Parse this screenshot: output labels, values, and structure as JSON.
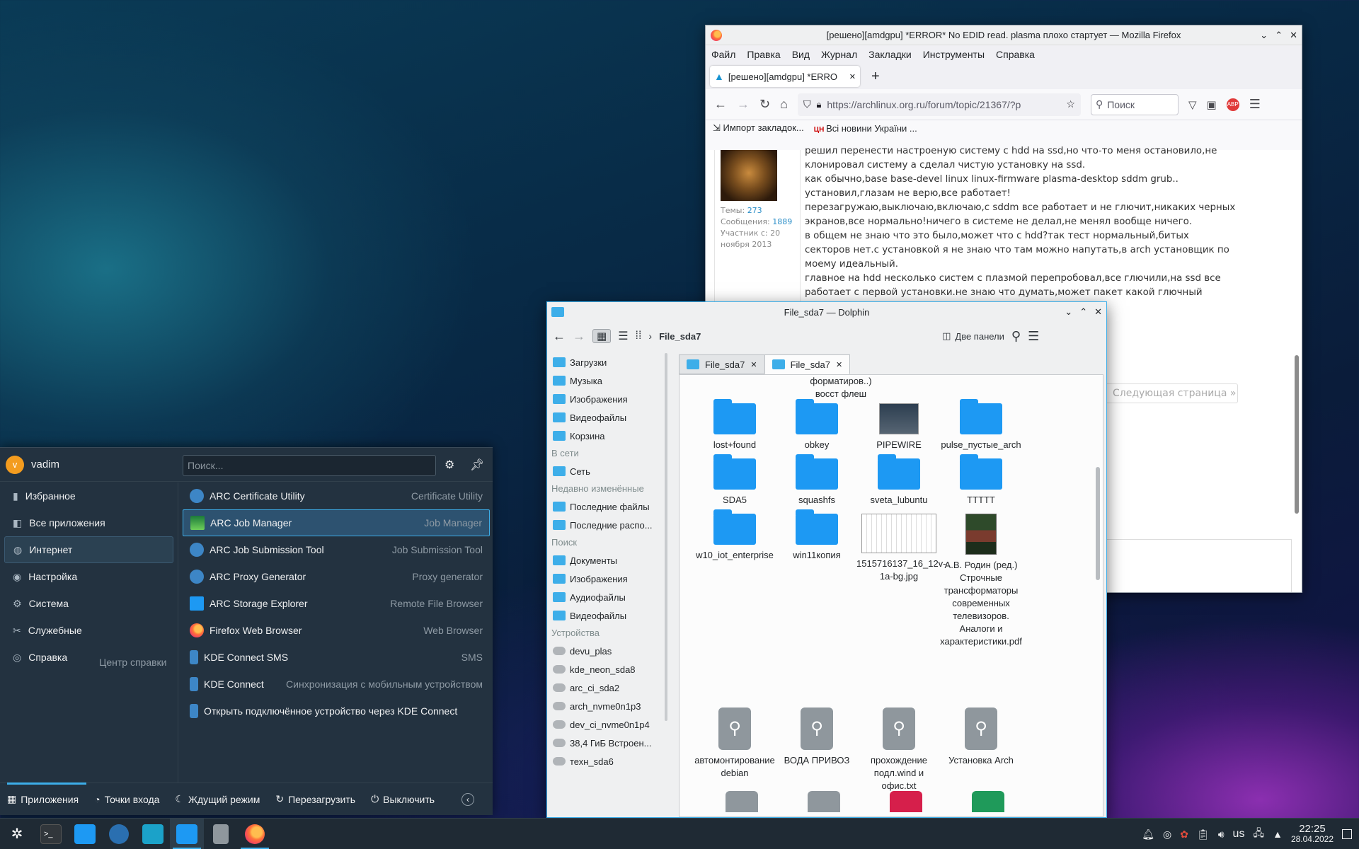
{
  "firefox": {
    "title": "[решено][amdgpu] *ERROR* No EDID read. plasma плохо стартует — Mozilla Firefox",
    "menu": [
      "Файл",
      "Правка",
      "Вид",
      "Журнал",
      "Закладки",
      "Инструменты",
      "Справка"
    ],
    "tab_label": "[решено][amdgpu] *ERRO",
    "url": "https://archlinux.org.ru/forum/topic/21367/?p",
    "search_placeholder": "Поиск",
    "bookmarks": [
      "Импорт закладок...",
      "Всі новини України ..."
    ],
    "post_text": [
      "решил перенести настроеную систему с hdd на ssd,но что-то меня остановило,не",
      "клонировал систему а сделал чистую установку на ssd.",
      "как обычно,base base-devel linux linux-firmware plasma-desktop sddm grub..",
      "установил,глазам не верю,все работает!",
      "перезагружаю,выключаю,включаю,с sddm все работает и не глючит,никаких черных",
      "экранов,все нормально!ничего в системе не делал,не менял вообще ничего.",
      "в общем не знаю что это было,может что с hdd?так тест нормальный,битых",
      "секторов нет.с установкой я не знаю что там можно напутать,в arch установщик по",
      "моему идеальный.",
      "главное на hdd несколько систем с плазмой перепробовал,все глючили,на ssd все",
      "работает с первой установки.не знаю что думать,может пакет какой глючный"
    ],
    "user": {
      "topics_label": "Темы:",
      "topics": "273",
      "msgs_label": "Сообщения:",
      "msgs": "1889",
      "since": "Участник с: 20 ноября 2013"
    },
    "next_page": "Следующая страница »"
  },
  "dolphin": {
    "title": "File_sda7 — Dolphin",
    "breadcrumb": "File_sda7",
    "split_label": "Две панели",
    "tabs": [
      "File_sda7",
      "File_sda7"
    ],
    "places": [
      "Загрузки",
      "Музыка",
      "Изображения",
      "Видеофайлы",
      "Корзина"
    ],
    "network_header": "В сети",
    "network": [
      "Сеть"
    ],
    "recent_header": "Недавно изменённые",
    "recent": [
      "Последние файлы",
      "Последние распо..."
    ],
    "search_header": "Поиск",
    "search": [
      "Документы",
      "Изображения",
      "Аудиофайлы",
      "Видеофайлы"
    ],
    "devices_header": "Устройства",
    "devices": [
      "devu_plas",
      "kde_neon_sda8",
      "arc_ci_sda2",
      "arch_nvme0n1p3",
      "dev_ci_nvme0n1p4",
      "38,4 ГиБ Встроен...",
      "техн_sda6"
    ],
    "top_cut": [
      "форматиров..)",
      "восст флеш"
    ],
    "items": [
      {
        "name": "lost+found",
        "kind": "folder"
      },
      {
        "name": "obkey",
        "kind": "folder"
      },
      {
        "name": "PIPEWIRE",
        "kind": "image"
      },
      {
        "name": "pulse_пустые_arch",
        "kind": "folder"
      },
      {
        "name": "SDA5",
        "kind": "folder"
      },
      {
        "name": "squashfs",
        "kind": "folder"
      },
      {
        "name": "sveta_lubuntu",
        "kind": "folder"
      },
      {
        "name": "TTTTT",
        "kind": "folder"
      },
      {
        "name": "w10_iot_enterprise",
        "kind": "folder"
      },
      {
        "name": "win11копия",
        "kind": "folder"
      },
      {
        "name": "1515716137_16_12v-1a-bg.jpg",
        "kind": "image"
      },
      {
        "name": "А.В. Родин (ред.) Строчные трансформаторы современных телевизоров. Аналоги и характеристики.pdf",
        "kind": "pdf"
      },
      {
        "name": "автомонтирование debian",
        "kind": "text"
      },
      {
        "name": "ВОДА ПРИВОЗ",
        "kind": "text"
      },
      {
        "name": "прохождение подл.wind и офис.txt",
        "kind": "text"
      },
      {
        "name": "Установка Arch",
        "kind": "text"
      }
    ]
  },
  "menu": {
    "user": "vadim",
    "avatar_letter": "v",
    "search_placeholder": "Поиск...",
    "categories": [
      "Избранное",
      "Все приложения",
      "Интернет",
      "Настройка",
      "Система",
      "Служебные",
      "Справка"
    ],
    "help_desc": "Центр справки",
    "apps": [
      {
        "name": "ARC Certificate Utility",
        "desc": "Certificate Utility"
      },
      {
        "name": "ARC Job Manager",
        "desc": "Job Manager"
      },
      {
        "name": "ARC Job Submission Tool",
        "desc": "Job Submission Tool"
      },
      {
        "name": "ARC Proxy Generator",
        "desc": "Proxy generator"
      },
      {
        "name": "ARC Storage Explorer",
        "desc": "Remote File Browser"
      },
      {
        "name": "Firefox Web Browser",
        "desc": "Web Browser"
      },
      {
        "name": "KDE Connect SMS",
        "desc": "SMS"
      },
      {
        "name": "KDE Connect",
        "desc": "Синхронизация с мобильным устройством"
      },
      {
        "name": "Открыть подключённое устройство через KDE Connect",
        "desc": ""
      }
    ],
    "footer": [
      "Приложения",
      "Точки входа",
      "Ждущий режим",
      "Перезагрузить",
      "Выключить"
    ]
  },
  "taskbar": {
    "lang": "us",
    "time": "22:25",
    "date": "28.04.2022"
  }
}
